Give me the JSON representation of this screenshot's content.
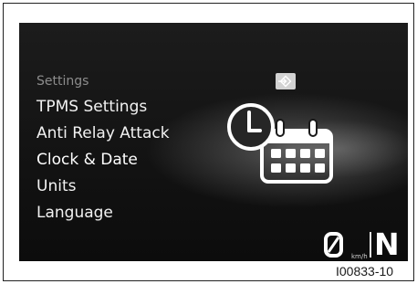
{
  "menu": {
    "header": "Settings",
    "items": [
      {
        "label": "TPMS Settings"
      },
      {
        "label": "Anti Relay Attack"
      },
      {
        "label": "Clock & Date"
      },
      {
        "label": "Units"
      },
      {
        "label": "Language"
      }
    ],
    "selected_index": 2
  },
  "icons": {
    "enter": "enter-arrow-icon",
    "illustration": "clock-calendar-icon",
    "speed": "speed-zero-icon"
  },
  "status": {
    "speed_unit": "km/h",
    "gear": "N"
  },
  "figure_code": "I00833-10"
}
